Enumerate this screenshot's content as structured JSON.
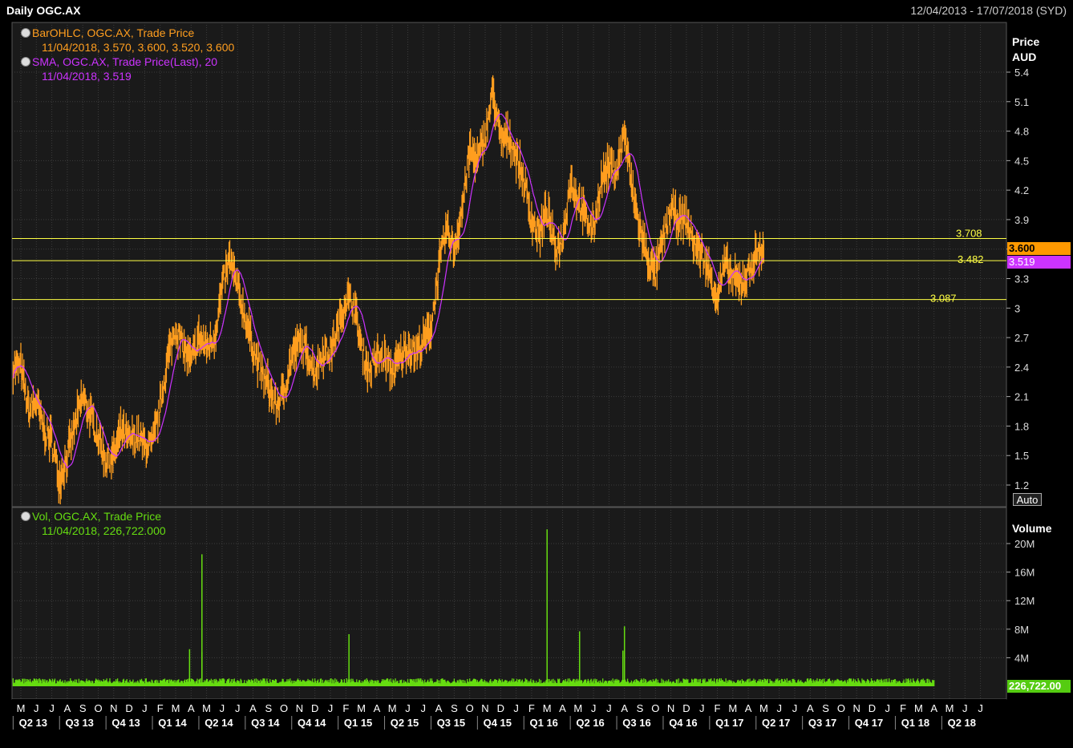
{
  "header": {
    "title": "Daily OGC.AX",
    "date_range": "12/04/2013 - 17/07/2018 (SYD)"
  },
  "legend": {
    "ohlc_label": "BarOHLC, OGC.AX, Trade Price",
    "ohlc_values": "11/04/2018, 3.570, 3.600, 3.520, 3.600",
    "sma_label": "SMA, OGC.AX, Trade Price(Last),  20",
    "sma_values": "11/04/2018, 3.519",
    "vol_label": "Vol, OGC.AX, Trade Price",
    "vol_values": "11/04/2018, 226,722.000"
  },
  "axes": {
    "price_title_1": "Price",
    "price_title_2": "AUD",
    "volume_title": "Volume",
    "auto_label": "Auto"
  },
  "tags": {
    "last_price": "3.600",
    "sma_last": "3.519",
    "volume_last": "226,722.00"
  },
  "colors": {
    "background": "#000000",
    "plot_bg": "#1a1a1a",
    "grid": "#3c3c3c",
    "ohlc": "#ff9e1f",
    "sma": "#cc33ff",
    "volume": "#66dd11",
    "levels": "#ffff44",
    "price_tag": "#ff9900",
    "sma_tag": "#cc33ff",
    "volume_tag": "#55cc11"
  },
  "chart_data": {
    "type": "line",
    "price_axis": {
      "ticks": [
        1.2,
        1.5,
        1.8,
        2.1,
        2.4,
        2.7,
        3,
        3.3,
        3.6,
        3.9,
        4.2,
        4.5,
        4.8,
        5.1,
        5.4
      ],
      "tick_labels": [
        "1.2",
        "1.5",
        "1.8",
        "2.1",
        "2.4",
        "2.7",
        "3",
        "3.3",
        "3.6",
        "3.9",
        "4.2",
        "4.5",
        "4.8",
        "5.1",
        "5.4"
      ],
      "range": [
        1.0,
        5.95
      ]
    },
    "volume_axis": {
      "ticks": [
        4,
        8,
        12,
        16,
        20
      ],
      "tick_labels": [
        "4M",
        "8M",
        "12M",
        "16M",
        "20M"
      ],
      "range": [
        0,
        23
      ]
    },
    "months": [
      "M",
      "J",
      "J",
      "A",
      "S",
      "O",
      "N",
      "D",
      "J",
      "F",
      "M",
      "A",
      "M",
      "J",
      "J",
      "A",
      "S",
      "O",
      "N",
      "D",
      "J",
      "F",
      "M",
      "A",
      "M",
      "J",
      "J",
      "A",
      "S",
      "O",
      "N",
      "D",
      "J",
      "F",
      "M",
      "A",
      "M",
      "J",
      "J",
      "A",
      "S",
      "O",
      "N",
      "D",
      "J",
      "F",
      "M",
      "A",
      "M",
      "J",
      "J",
      "A",
      "S",
      "O",
      "N",
      "D",
      "J",
      "F",
      "M",
      "A",
      "M",
      "J",
      "J"
    ],
    "quarters": [
      "Q2 13",
      "Q3 13",
      "Q4 13",
      "Q1 14",
      "Q2 14",
      "Q3 14",
      "Q4 14",
      "Q1 15",
      "Q2 15",
      "Q3 15",
      "Q4 15",
      "Q1 16",
      "Q2 16",
      "Q3 16",
      "Q4 16",
      "Q1 17",
      "Q2 17",
      "Q3 17",
      "Q4 17",
      "Q1 18",
      "Q2 18"
    ],
    "price_series": {
      "name": "BarOHLC, OGC.AX, Trade Price",
      "month_index": [
        0,
        0.5,
        1,
        1.5,
        2,
        2.5,
        3,
        3.5,
        4,
        4.5,
        5,
        5.5,
        6,
        6.5,
        7,
        7.5,
        8,
        8.5,
        9,
        9.5,
        10,
        10.5,
        11,
        11.5,
        12,
        12.5,
        13,
        13.5,
        14,
        14.5,
        15,
        15.5,
        16,
        16.5,
        17,
        17.5,
        18,
        18.5,
        19,
        19.5,
        20,
        20.5,
        21,
        21.5,
        22,
        22.5,
        23,
        23.5,
        24,
        24.5,
        25,
        25.5,
        26,
        26.5,
        27,
        27.5,
        28,
        28.5,
        29,
        29.5,
        30,
        30.5,
        31,
        31.5,
        32,
        32.5,
        33,
        33.5,
        34,
        34.5,
        35,
        35.5,
        36,
        36.5,
        37,
        37.5,
        38,
        38.5,
        39,
        39.5,
        40,
        40.5,
        41,
        41.5,
        42,
        42.5,
        43,
        43.5,
        44,
        44.5,
        45,
        45.5,
        46,
        46.5,
        47,
        47.5,
        48,
        48.5,
        49,
        49.5,
        50,
        50.5,
        51,
        51.5,
        52,
        52.5,
        53,
        53.5,
        54,
        54.5,
        55,
        55.5,
        56,
        56.5,
        57,
        57.5,
        58,
        58.5,
        59
      ],
      "values": [
        2.4,
        1.95,
        2.05,
        1.75,
        1.65,
        1.25,
        1.5,
        1.8,
        2.1,
        1.9,
        1.7,
        1.45,
        1.5,
        1.75,
        1.65,
        1.7,
        1.6,
        1.6,
        2.0,
        2.5,
        2.8,
        2.6,
        2.45,
        2.7,
        2.6,
        2.7,
        3.2,
        3.5,
        3.2,
        2.9,
        2.6,
        2.35,
        2.2,
        2.0,
        2.15,
        2.5,
        2.65,
        2.55,
        2.35,
        2.55,
        2.55,
        2.8,
        3.1,
        3.05,
        2.6,
        2.35,
        2.5,
        2.5,
        2.35,
        2.5,
        2.6,
        2.55,
        2.65,
        2.8,
        3.4,
        3.8,
        3.6,
        4.0,
        4.6,
        4.5,
        4.75,
        5.2,
        4.7,
        4.75,
        4.55,
        4.3,
        3.9,
        3.75,
        4.0,
        3.6,
        3.7,
        4.3,
        4.1,
        3.9,
        3.8,
        4.3,
        4.45,
        4.4,
        4.8,
        4.2,
        3.8,
        3.5,
        3.35,
        3.7,
        4.0,
        3.9,
        3.9,
        3.65,
        3.55,
        3.35,
        3.1,
        3.45,
        3.3,
        3.25,
        3.35,
        3.55,
        3.6
      ],
      "dense_bars": true
    },
    "sma_series": {
      "name": "SMA, OGC.AX, Trade Price(Last),  20"
    },
    "volume_series": {
      "name": "Vol, OGC.AX, Trade Price",
      "baseline": 0.8,
      "spikes": [
        [
          10.9,
          5.2
        ],
        [
          11.7,
          18.5
        ],
        [
          11.7,
          4.8
        ],
        [
          21.2,
          7.3
        ],
        [
          34.0,
          22.0
        ],
        [
          36.1,
          7.7
        ],
        [
          39.0,
          8.4
        ],
        [
          38.9,
          5.0
        ]
      ],
      "unit": "M"
    },
    "levels": [
      {
        "value": 3.708,
        "label": "3.708"
      },
      {
        "value": 3.482,
        "label": "3.482"
      },
      {
        "value": 3.087,
        "label": "3.087"
      }
    ]
  }
}
